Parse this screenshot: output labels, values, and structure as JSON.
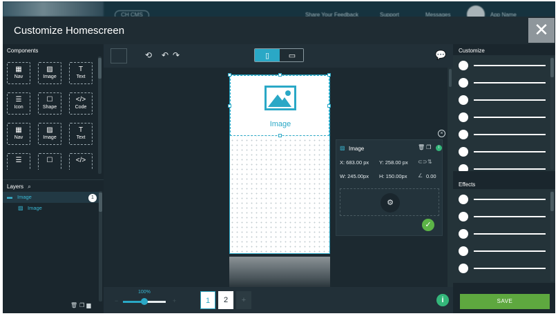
{
  "appbar": {
    "cms_label": "CH CMS",
    "feedback": "Share Your Feedback",
    "support": "Support",
    "messages": "Messages",
    "user_name": "App Name"
  },
  "dialog": {
    "title": "Customize Homescreen",
    "close_glyph": "✕"
  },
  "left": {
    "components_heading": "Components",
    "components": [
      {
        "label": "Nav",
        "icon": "nav-icon",
        "glyph": "▦"
      },
      {
        "label": "Image",
        "icon": "image-icon",
        "glyph": "▨"
      },
      {
        "label": "Text",
        "icon": "text-icon",
        "glyph": "T"
      },
      {
        "label": "Icon",
        "icon": "icon-list-icon",
        "glyph": "☰"
      },
      {
        "label": "Shape",
        "icon": "shape-icon",
        "glyph": "☐"
      },
      {
        "label": "Code",
        "icon": "code-icon",
        "glyph": "</>"
      },
      {
        "label": "Nav",
        "icon": "nav-icon",
        "glyph": "▦"
      },
      {
        "label": "Image",
        "icon": "image-icon",
        "glyph": "▨"
      },
      {
        "label": "Text",
        "icon": "text-icon",
        "glyph": "T"
      },
      {
        "label": "",
        "icon": "icon-list-icon",
        "glyph": "☰"
      },
      {
        "label": "",
        "icon": "shape-icon",
        "glyph": "☐"
      },
      {
        "label": "",
        "icon": "code-icon",
        "glyph": "</>"
      }
    ],
    "layers_heading": "Layers",
    "layers": [
      {
        "label": "Image",
        "badge": "1"
      },
      {
        "label": "Image"
      }
    ]
  },
  "toolbar": {
    "history_glyph": "⟲",
    "undo_glyph": "↶",
    "redo_glyph": "↷",
    "phone_glyph": "▯",
    "tablet_glyph": "▭",
    "chat_glyph": "💬"
  },
  "canvas": {
    "image_label": "Image"
  },
  "props": {
    "title": "Image",
    "x": "X: 683.00 px",
    "y": "Y: 258.00 px",
    "w": "W: 245.00px",
    "h": "H: 150.00px",
    "angle": "0.00",
    "info_glyph": "i",
    "ok_glyph": "✓",
    "close_glyph": "×"
  },
  "bottom": {
    "zoom_label": "100%",
    "zoom_value": 0.5,
    "pages": [
      "1",
      "2"
    ],
    "add_page": "+",
    "help_glyph": "i"
  },
  "right": {
    "customize_heading": "Customize",
    "customize_toggles": 7,
    "effects_heading": "Effects",
    "effects_toggles": 5,
    "save_label": "SAVE"
  },
  "colors": {
    "accent": "#2aa8c6",
    "save": "#5ea83f",
    "help": "#34b67a",
    "chat": "#f29a1f"
  }
}
